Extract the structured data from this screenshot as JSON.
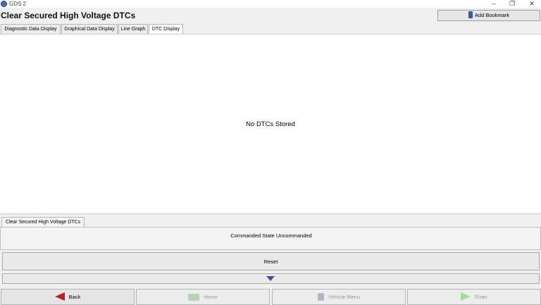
{
  "window": {
    "title": "GDS 2",
    "icon": "gds-logo-icon"
  },
  "header": {
    "title": "Clear Secured High Voltage DTCs",
    "bookmark_label": "Add Bookmark",
    "bookmark_icon": "bookmark-icon"
  },
  "tabs": [
    {
      "label": "Diagnostic Data Display",
      "active": false
    },
    {
      "label": "Graphical Data Display",
      "active": false
    },
    {
      "label": "Line Graph",
      "active": false
    },
    {
      "label": "DTC Display",
      "active": true
    }
  ],
  "main": {
    "message": "No DTCs Stored"
  },
  "lower": {
    "tab_label": "Clear Secured High Voltage DTCs",
    "commanded_state": "Commanded State  Uncommanded",
    "reset_label": "Reset"
  },
  "nav": {
    "back": {
      "label": "Back",
      "icon": "back-arrow-icon",
      "color": "#c21d1d"
    },
    "home": {
      "label": "Home",
      "icon": "home-icon",
      "enabled": false
    },
    "vehicle_menu": {
      "label": "Vehicle Menu",
      "icon": "vehicle-menu-icon",
      "enabled": false
    },
    "enter": {
      "label": "Enter",
      "icon": "enter-arrow-icon",
      "enabled": false
    }
  },
  "colors": {
    "accent": "#3d6fb6",
    "back_red": "#c21d1d",
    "enter_green": "#a7d8a0"
  }
}
